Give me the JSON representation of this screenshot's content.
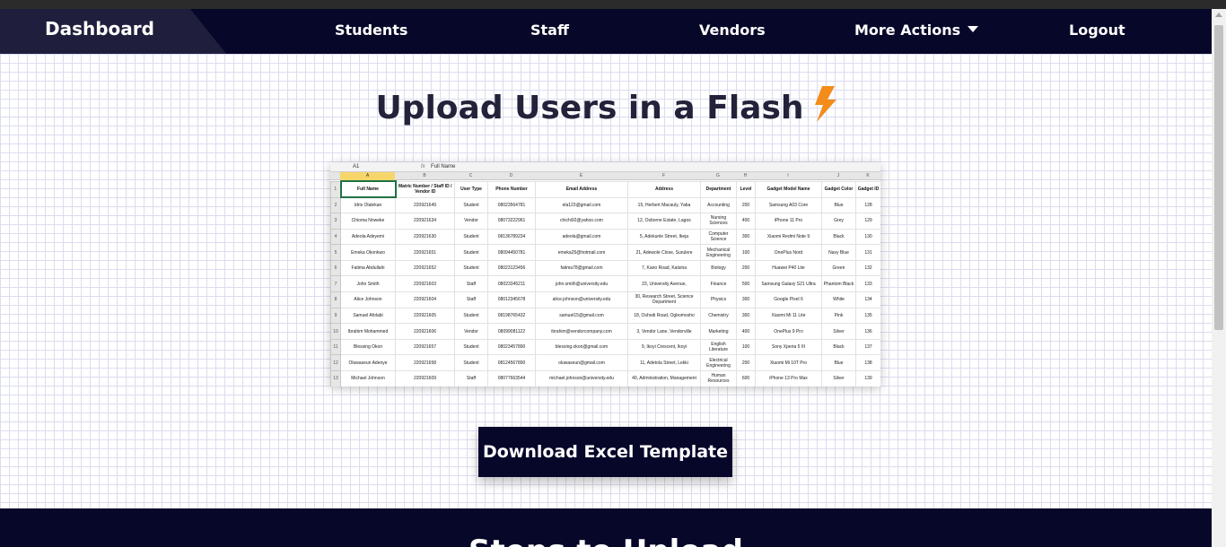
{
  "nav": {
    "brand": "Dashboard",
    "items": [
      "Students",
      "Staff",
      "Vendors",
      "More Actions",
      "Logout"
    ]
  },
  "hero": {
    "title": "Upload Users in a Flash",
    "icon": "lightning-bolt-icon"
  },
  "sheet": {
    "cell_ref": "A1",
    "formula_value": "Full Name",
    "columns": [
      "A",
      "B",
      "C",
      "D",
      "E",
      "F",
      "G",
      "H",
      "I",
      "J",
      "K"
    ],
    "headers": [
      "Full Name",
      "Matric Number / Staff ID / Vendor ID",
      "User Type",
      "Phone Number",
      "Email Address",
      "Address",
      "Department",
      "Level",
      "Gadget Model Name",
      "Gadget Color",
      "Gadget ID"
    ],
    "rows": [
      [
        "Idris Olalekan",
        "220921649",
        "Student",
        "08023564781",
        "ela123@gmail.com",
        "15, Herbert Macauly, Yaba",
        "Accounting",
        "200",
        "Samsung A03 Core",
        "Blue",
        "128"
      ],
      [
        "Chioma Nnweke",
        "220921634",
        "Vendor",
        "08073222961",
        "chichi92@yahoo.com",
        "12, Osborne Estate, Lagos",
        "Nursing Sciences",
        "400",
        "iPhone 11 Pro",
        "Grey",
        "129"
      ],
      [
        "Adeola Adeyemi",
        "220921630",
        "Student",
        "08136789234",
        "adeola@gmail.com",
        "5, Adekunle Street, Ikeja",
        "Computer Science",
        "300",
        "Xiaomi Redmi Note 9",
        "Black",
        "130"
      ],
      [
        "Emeka Okonkwo",
        "220921651",
        "Student",
        "08094450781",
        "emeka25@hotmail.com",
        "21, Adewole Close, Surulere",
        "Mechanical Engineering",
        "100",
        "OnePlus Nord",
        "Navy Blue",
        "131"
      ],
      [
        "Fatima Abdullahi",
        "220921652",
        "Student",
        "08023123456",
        "fatima78@gmail.com",
        "7, Kano Road, Katsina",
        "Biology",
        "200",
        "Huawei P40 Lite",
        "Green",
        "132"
      ],
      [
        "John Smith",
        "220921603",
        "Staff",
        "08023345211",
        "john.smith@university.edu",
        "23, University Avenue,",
        "Finance",
        "500",
        "Samsung Galaxy S21 Ultra",
        "Phantom Black",
        "133"
      ],
      [
        "Alice Johnson",
        "220921604",
        "Staff",
        "08012345678",
        "alice.johnson@university.edu",
        "30, Research Street, Science Department",
        "Physics",
        "300",
        "Google Pixel 6",
        "White",
        "134"
      ],
      [
        "Samuel Afolabi",
        "220921605",
        "Student",
        "08198765432",
        "samuel15@gmail.com",
        "18, Oshodi Road, Ogbomosho",
        "Chemistry",
        "300",
        "Xiaomi Mi 11 Lite",
        "Pink",
        "135"
      ],
      [
        "Ibrahim Mohammed",
        "220921606",
        "Vendor",
        "08099081122",
        "ibrahim@vendorcompany.com",
        "3, Vendor Lane, Vendorville",
        "Marketing",
        "400",
        "OnePlus 9 Pro",
        "Silver",
        "136"
      ],
      [
        "Blessing Okon",
        "220921657",
        "Student",
        "08023457890",
        "blessing.okon@gmail.com",
        "9, Ikoyi Crescent, Ikoyi",
        "English Literature",
        "100",
        "Sony Xperia 5 III",
        "Black",
        "137"
      ],
      [
        "Oluwaseun Adeoye",
        "220921658",
        "Student",
        "08124567890",
        "oluwaseun@gmail.com",
        "11, Adetola Street, Lekki",
        "Electrical Engineering",
        "200",
        "Xiaomi Mi 10T Pro",
        "Blue",
        "138"
      ],
      [
        "Michael Johnson",
        "220921609",
        "Staff",
        "08077663544",
        "michael.johnson@university.edu",
        "40, Administration, Management",
        "Human Resources",
        "600",
        "iPhone 13 Pro Max",
        "Silver",
        "139"
      ]
    ]
  },
  "actions": {
    "download_label": "Download Excel Template"
  },
  "next_section": {
    "title": "Steps to Upload"
  },
  "colors": {
    "navy": "#07072a",
    "accent": "#f28c1b",
    "brand_bg": "#1f1f3d"
  }
}
